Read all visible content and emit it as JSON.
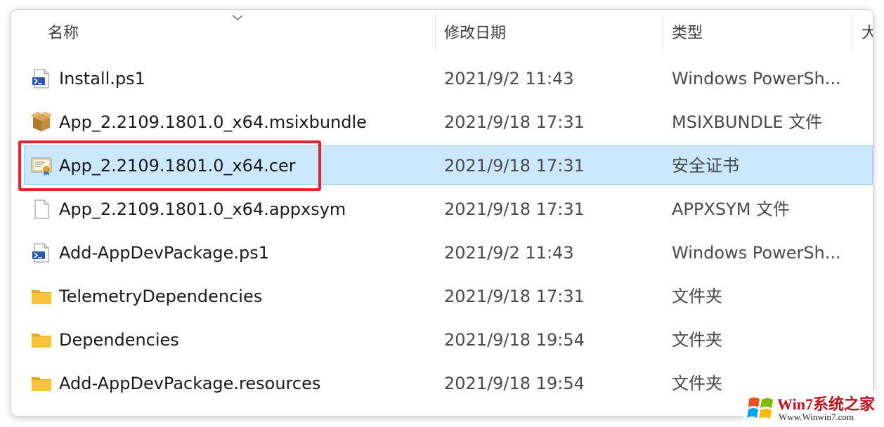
{
  "columns": {
    "name": "名称",
    "date_modified": "修改日期",
    "type": "类型",
    "size": "大"
  },
  "files": [
    {
      "name": "Install.ps1",
      "date": "2021/9/2 11:43",
      "type": "Windows PowerSh...",
      "icon": "powershell-script-icon"
    },
    {
      "name": "App_2.2109.1801.0_x64.msixbundle",
      "date": "2021/9/18 17:31",
      "type": "MSIXBUNDLE 文件",
      "icon": "package-box-icon"
    },
    {
      "name": "App_2.2109.1801.0_x64.cer",
      "date": "2021/9/18 17:31",
      "type": "安全证书",
      "icon": "certificate-icon",
      "selected": true
    },
    {
      "name": "App_2.2109.1801.0_x64.appxsym",
      "date": "2021/9/18 17:31",
      "type": "APPXSYM 文件",
      "icon": "blank-file-icon"
    },
    {
      "name": "Add-AppDevPackage.ps1",
      "date": "2021/9/2 11:43",
      "type": "Windows PowerSh...",
      "icon": "powershell-script-icon"
    },
    {
      "name": "TelemetryDependencies",
      "date": "2021/9/18 17:31",
      "type": "文件夹",
      "icon": "folder-icon"
    },
    {
      "name": "Dependencies",
      "date": "2021/9/18 19:54",
      "type": "文件夹",
      "icon": "folder-icon"
    },
    {
      "name": "Add-AppDevPackage.resources",
      "date": "2021/9/18 19:54",
      "type": "文件夹",
      "icon": "folder-icon"
    }
  ],
  "colors": {
    "selection_bg": "#cce8ff",
    "selection_border": "#99d1ff",
    "highlight_box": "#e8232a",
    "folder": "#f8c43a"
  },
  "watermark": {
    "title": "Win7系统之家",
    "url": "Www.Winwin7.com"
  }
}
